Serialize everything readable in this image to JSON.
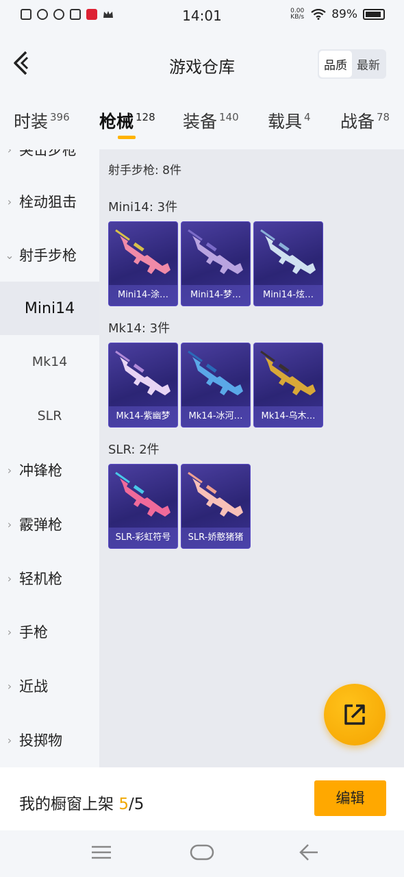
{
  "status_bar": {
    "time": "14:01",
    "net_speed_value": "0.00",
    "net_speed_unit": "KB/s",
    "battery": "89%"
  },
  "header": {
    "title": "游戏仓库",
    "sort_options": [
      "品质",
      "最新"
    ],
    "sort_active": "品质"
  },
  "tabs": [
    {
      "label": "时装",
      "count": "396"
    },
    {
      "label": "枪械",
      "count": "128",
      "active": true
    },
    {
      "label": "装备",
      "count": "140"
    },
    {
      "label": "载具",
      "count": "4"
    },
    {
      "label": "战备",
      "count": "78"
    }
  ],
  "sidebar": {
    "items": [
      {
        "label": "突击步枪"
      },
      {
        "label": "栓动狙击"
      },
      {
        "label": "射手步枪",
        "expanded": true
      },
      {
        "label": "Mini14",
        "sub": true,
        "selected": true
      },
      {
        "label": "Mk14",
        "sub": true
      },
      {
        "label": "SLR",
        "sub": true
      },
      {
        "label": "冲锋枪"
      },
      {
        "label": "霰弹枪"
      },
      {
        "label": "轻机枪"
      },
      {
        "label": "手枪"
      },
      {
        "label": "近战"
      },
      {
        "label": "投掷物"
      }
    ]
  },
  "content": {
    "summary": "射手步枪: 8件",
    "groups": [
      {
        "title": "Mini14: 3件",
        "items": [
          {
            "label": "Mini14-涂…",
            "gun_color": "#f08aa8",
            "accent": "#d8c04a"
          },
          {
            "label": "Mini14-梦…",
            "gun_color": "#b9a4e0",
            "accent": "#7b6bc8"
          },
          {
            "label": "Mini14-炫…",
            "gun_color": "#cfe0f0",
            "accent": "#8ab0d8"
          }
        ]
      },
      {
        "title": "Mk14: 3件",
        "items": [
          {
            "label": "Mk14-紫幽梦",
            "gun_color": "#e8d4f4",
            "accent": "#b08ad8"
          },
          {
            "label": "Mk14-冰河…",
            "gun_color": "#5aa8e8",
            "accent": "#2a6ab8"
          },
          {
            "label": "Mk14-乌木…",
            "gun_color": "#d8a838",
            "accent": "#3a3030"
          }
        ]
      },
      {
        "title": "SLR: 2件",
        "items": [
          {
            "label": "SLR-彩虹符号",
            "gun_color": "#f06a9a",
            "accent": "#48c8e8"
          },
          {
            "label": "SLR-娇憨猪猪",
            "gun_color": "#f8c0b8",
            "accent": "#f0a090"
          }
        ]
      }
    ]
  },
  "bottom_bar": {
    "label": "我的橱窗上架",
    "current": "5",
    "separator": "/",
    "total": "5",
    "edit_label": "编辑"
  },
  "colors": {
    "accent": "#ffa800",
    "card_bg": "#2c2575"
  }
}
